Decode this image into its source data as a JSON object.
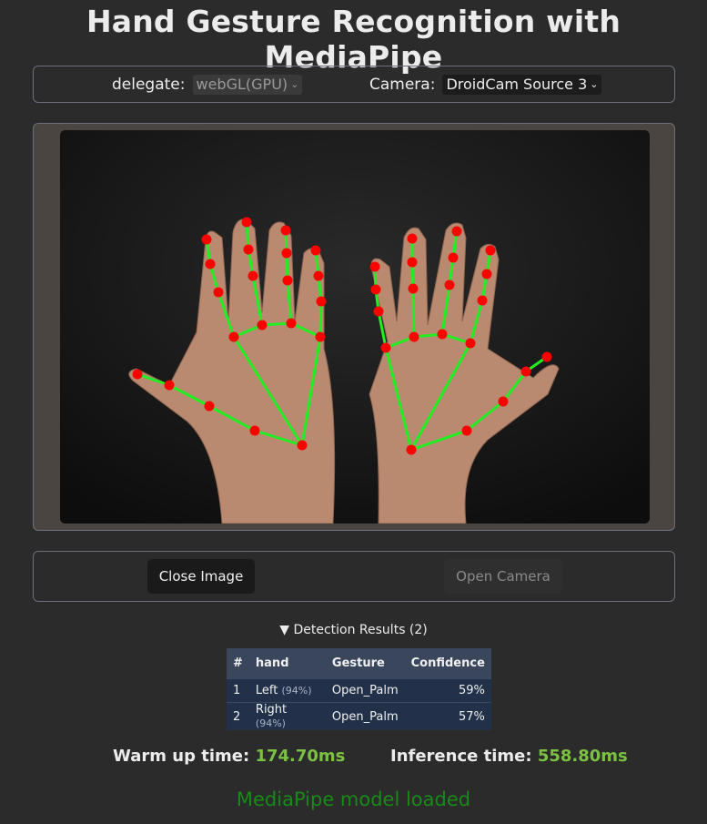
{
  "page_title": "Hand Gesture Recognition with MediaPipe",
  "controls": {
    "delegate_label": "delegate:",
    "delegate_value": "webGL(GPU)",
    "camera_label": "Camera:",
    "camera_value": "DroidCam Source 3"
  },
  "icons": {
    "select_arrow": "chevron-down-icon",
    "disclosure": "triangle-down-icon"
  },
  "buttons": {
    "close_image": "Close Image",
    "open_camera": "Open Camera"
  },
  "results": {
    "summary_marker": "▼",
    "summary_label": "Detection Results (2)",
    "headers": [
      "#",
      "hand",
      "Gesture",
      "Confidence"
    ],
    "rows": [
      {
        "index": "1",
        "hand": "Left",
        "hand_score": "(94%)",
        "gesture": "Open_Palm",
        "confidence": "59%"
      },
      {
        "index": "2",
        "hand": "Right",
        "hand_score": "(94%)",
        "gesture": "Open_Palm",
        "confidence": "57%"
      }
    ]
  },
  "timing": {
    "warmup_label": "Warm up time:",
    "warmup_value": "174.70ms",
    "inference_label": "Inference time:",
    "inference_value": "558.80ms"
  },
  "status": "MediaPipe model loaded",
  "colors": {
    "landmark": "#ff0000",
    "connection": "#22ee22",
    "status_text": "#188a18",
    "timing_value": "#7cc242"
  }
}
